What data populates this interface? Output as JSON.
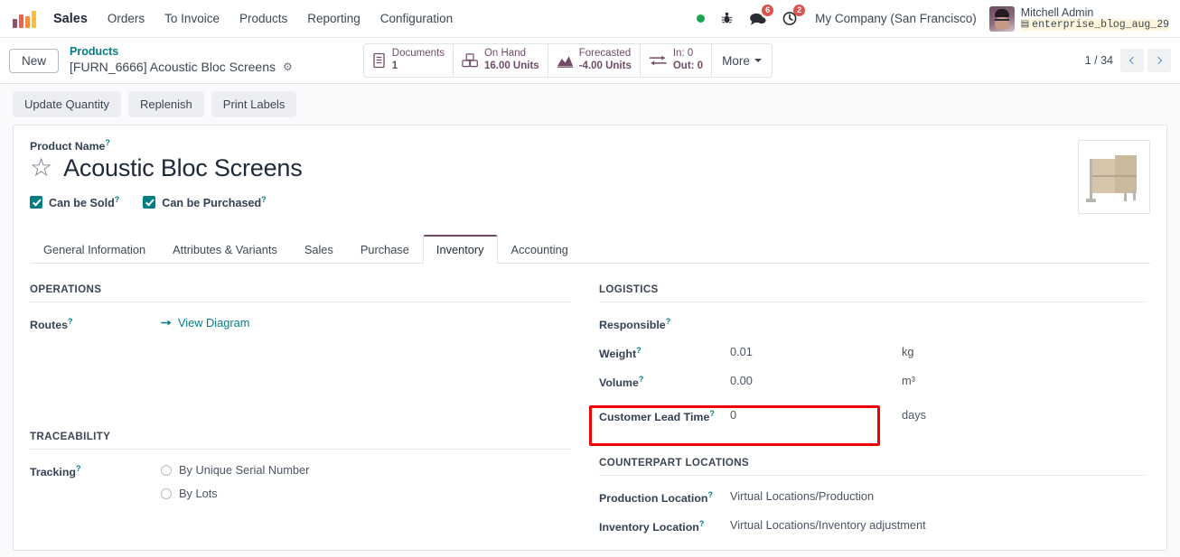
{
  "navbar": {
    "app_name": "Sales",
    "menu_items": [
      "Orders",
      "To Invoice",
      "Products",
      "Reporting",
      "Configuration"
    ],
    "logo_icon": "odoo-bars-logo",
    "status_dot_icon": "online-status-dot",
    "bug_icon": "bug-icon",
    "messages_icon": "messages-icon",
    "messages_count": "6",
    "activities_icon": "activities-clock-icon",
    "activities_count": "2",
    "company": "My Company (San Francisco)",
    "user_name": "Mitchell Admin",
    "database": "enterprise_blog_aug_29",
    "database_icon": "database-icon",
    "avatar_icon": "user-avatar"
  },
  "control_panel": {
    "new_label": "New",
    "breadcrumb_parent": "Products",
    "breadcrumb_current": "[FURN_6666] Acoustic Bloc Screens",
    "gear_icon": "gear-icon",
    "stat_buttons": [
      {
        "label": "Documents",
        "value": "1",
        "icon": "document-icon"
      },
      {
        "label": "On Hand",
        "value": "16.00 Units",
        "icon": "boxes-icon"
      },
      {
        "label": "Forecasted",
        "value": "-4.00 Units",
        "icon": "area-chart-icon"
      },
      {
        "label": "In: 0",
        "value": "Out: 0",
        "icon": "exchange-arrows-icon"
      }
    ],
    "more_label": "More",
    "pager_text": "1 / 34",
    "prev_icon": "chevron-left-icon",
    "next_icon": "chevron-right-icon"
  },
  "action_bar": {
    "buttons": [
      "Update Quantity",
      "Replenish",
      "Print Labels"
    ]
  },
  "form": {
    "product_name_label": "Product Name",
    "product_name": "Acoustic Bloc Screens",
    "favorite_icon": "star-icon",
    "product_image_icon": "acoustic-bloc-screens-image",
    "checkboxes": [
      {
        "label": "Can be Sold",
        "checked": true
      },
      {
        "label": "Can be Purchased",
        "checked": true
      }
    ],
    "tabs": [
      {
        "label": "General Information",
        "active": false
      },
      {
        "label": "Attributes & Variants",
        "active": false
      },
      {
        "label": "Sales",
        "active": false
      },
      {
        "label": "Purchase",
        "active": false
      },
      {
        "label": "Inventory",
        "active": true
      },
      {
        "label": "Accounting",
        "active": false
      }
    ],
    "operations": {
      "title": "OPERATIONS",
      "routes_label": "Routes",
      "view_diagram_label": "View Diagram",
      "view_diagram_icon": "arrow-right-icon"
    },
    "traceability": {
      "title": "TRACEABILITY",
      "tracking_label": "Tracking",
      "options": [
        {
          "label": "By Unique Serial Number",
          "selected": false
        },
        {
          "label": "By Lots",
          "selected": false
        }
      ]
    },
    "logistics": {
      "title": "LOGISTICS",
      "rows": [
        {
          "label": "Responsible",
          "value": "",
          "unit": ""
        },
        {
          "label": "Weight",
          "value": "0.01",
          "unit": "kg"
        },
        {
          "label": "Volume",
          "value": "0.00",
          "unit": "m³"
        },
        {
          "label": "Customer Lead Time",
          "value": "0",
          "unit": "days",
          "highlighted": true
        }
      ]
    },
    "counterpart_locations": {
      "title": "COUNTERPART LOCATIONS",
      "rows": [
        {
          "label": "Production Location",
          "value": "Virtual Locations/Production"
        },
        {
          "label": "Inventory Location",
          "value": "Virtual Locations/Inventory adjustment"
        }
      ]
    }
  },
  "annotation": {
    "color": "#f00000",
    "target": "customer-lead-time-field"
  }
}
